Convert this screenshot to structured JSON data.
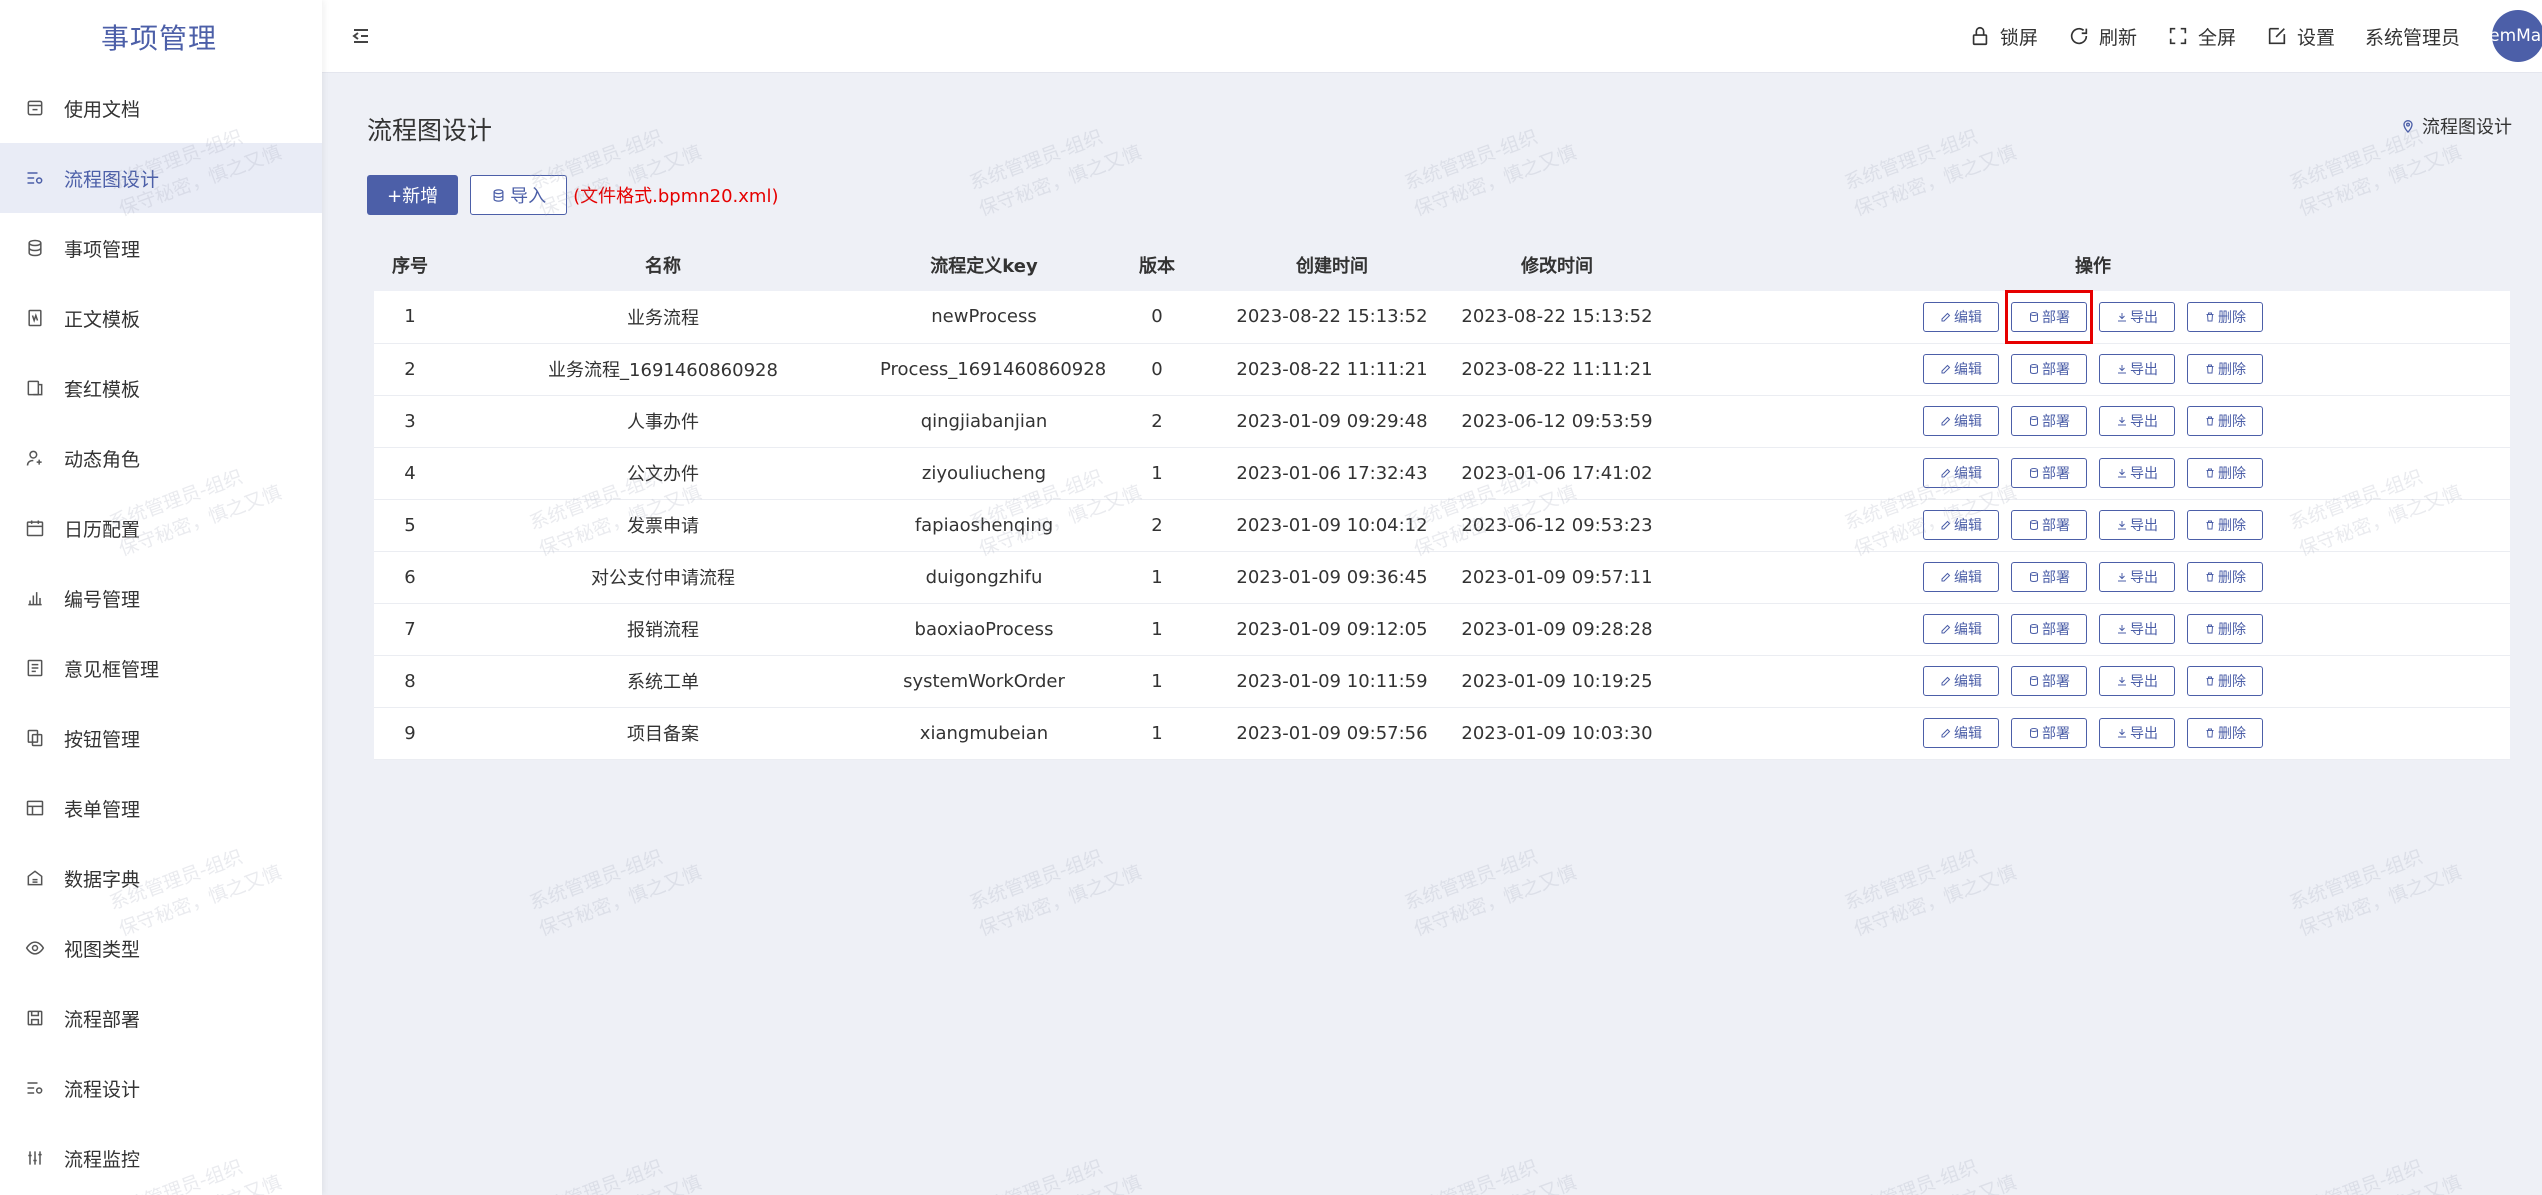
{
  "app": {
    "title": "事项管理"
  },
  "sidebar": {
    "items": [
      {
        "label": "使用文档",
        "icon": "document-box-icon",
        "active": false
      },
      {
        "label": "流程图设计",
        "icon": "flow-settings-icon",
        "active": true
      },
      {
        "label": "事项管理",
        "icon": "database-icon",
        "active": false
      },
      {
        "label": "正文模板",
        "icon": "template-icon",
        "active": false
      },
      {
        "label": "套红模板",
        "icon": "template-red-icon",
        "active": false
      },
      {
        "label": "动态角色",
        "icon": "user-add-icon",
        "active": false
      },
      {
        "label": "日历配置",
        "icon": "calendar-icon",
        "active": false
      },
      {
        "label": "编号管理",
        "icon": "bar-chart-icon",
        "active": false
      },
      {
        "label": "意见框管理",
        "icon": "form-box-icon",
        "active": false
      },
      {
        "label": "按钮管理",
        "icon": "copy-icon",
        "active": false
      },
      {
        "label": "表单管理",
        "icon": "table-icon",
        "active": false
      },
      {
        "label": "数据字典",
        "icon": "dictionary-icon",
        "active": false
      },
      {
        "label": "视图类型",
        "icon": "eye-icon",
        "active": false
      },
      {
        "label": "流程部署",
        "icon": "save-icon",
        "active": false
      },
      {
        "label": "流程设计",
        "icon": "flow-design-icon",
        "active": false
      },
      {
        "label": "流程监控",
        "icon": "sliders-icon",
        "active": false
      }
    ]
  },
  "header": {
    "lock_label": "锁屏",
    "refresh_label": "刷新",
    "fullscreen_label": "全屏",
    "settings_label": "设置",
    "username": "系统管理员",
    "avatar_text": "emMan"
  },
  "page": {
    "title": "流程图设计",
    "breadcrumb": "流程图设计",
    "add_label": "+新增",
    "import_label": "导入",
    "file_hint": "(文件格式.bpmn20.xml)"
  },
  "table": {
    "headers": [
      "序号",
      "名称",
      "流程定义key",
      "版本",
      "创建时间",
      "修改时间",
      "操作"
    ],
    "op_labels": {
      "edit": "编辑",
      "deploy": "部署",
      "export": "导出",
      "delete": "删除"
    },
    "rows": [
      {
        "no": "1",
        "name": "业务流程",
        "key": "newProcess",
        "version": "0",
        "created": "2023-08-22 15:13:52",
        "modified": "2023-08-22 15:13:52"
      },
      {
        "no": "2",
        "name": "业务流程_1691460860928",
        "key": "Process_1691460860928",
        "version": "0",
        "created": "2023-08-22 11:11:21",
        "modified": "2023-08-22 11:11:21"
      },
      {
        "no": "3",
        "name": "人事办件",
        "key": "qingjiabanjian",
        "version": "2",
        "created": "2023-01-09 09:29:48",
        "modified": "2023-06-12 09:53:59"
      },
      {
        "no": "4",
        "name": "公文办件",
        "key": "ziyouliucheng",
        "version": "1",
        "created": "2023-01-06 17:32:43",
        "modified": "2023-01-06 17:41:02"
      },
      {
        "no": "5",
        "name": "发票申请",
        "key": "fapiaoshenqing",
        "version": "2",
        "created": "2023-01-09 10:04:12",
        "modified": "2023-06-12 09:53:23"
      },
      {
        "no": "6",
        "name": "对公支付申请流程",
        "key": "duigongzhifu",
        "version": "1",
        "created": "2023-01-09 09:36:45",
        "modified": "2023-01-09 09:57:11"
      },
      {
        "no": "7",
        "name": "报销流程",
        "key": "baoxiaoProcess",
        "version": "1",
        "created": "2023-01-09 09:12:05",
        "modified": "2023-01-09 09:28:28"
      },
      {
        "no": "8",
        "name": "系统工单",
        "key": "systemWorkOrder",
        "version": "1",
        "created": "2023-01-09 10:11:59",
        "modified": "2023-01-09 10:19:25"
      },
      {
        "no": "9",
        "name": "项目备案",
        "key": "xiangmubeian",
        "version": "1",
        "created": "2023-01-09 09:57:56",
        "modified": "2023-01-09 10:03:30"
      }
    ]
  },
  "watermark": {
    "line1": "系统管理员-组织",
    "line2": "保守秘密，慎之又慎"
  },
  "colors": {
    "primary": "#4c5fa8",
    "hint": "#e60000",
    "background": "#eef0f6"
  }
}
